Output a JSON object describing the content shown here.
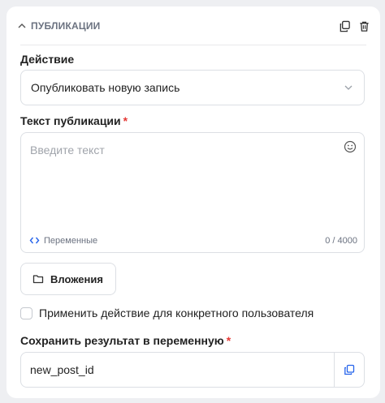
{
  "section": {
    "title": "ПУБЛИКАЦИИ",
    "icons": {
      "collapse": "chevron-up-icon",
      "copy": "copy-icon",
      "delete": "trash-icon"
    }
  },
  "action": {
    "label": "Действие",
    "value": "Опубликовать новую запись",
    "icon": "chevron-down-icon"
  },
  "post_text": {
    "label": "Текст публикации",
    "required_mark": "*",
    "placeholder": "Введите текст",
    "variables_label": "Переменные",
    "counter": "0 / 4000",
    "icons": {
      "emoji": "emoji-icon",
      "variables": "code-icon"
    }
  },
  "attachments": {
    "label": "Вложения",
    "icon": "folder-icon"
  },
  "specific_user": {
    "label": "Применить действие для конкретного пользователя",
    "checked": false
  },
  "save_result": {
    "label": "Сохранить результат в переменную",
    "required_mark": "*",
    "value": "new_post_id",
    "icon": "copy-icon"
  },
  "colors": {
    "accent": "#2563eb",
    "required": "#e53935",
    "border": "#dcdfe4",
    "background": "#eeeff2"
  }
}
